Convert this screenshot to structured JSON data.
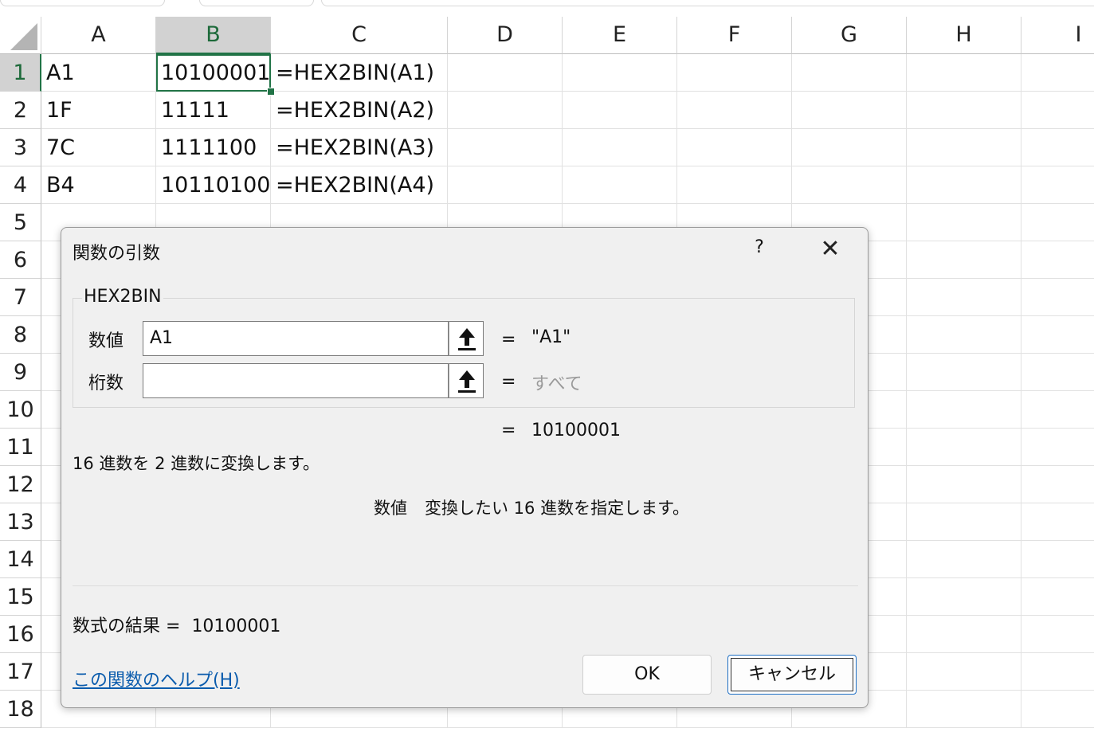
{
  "sheet": {
    "columns": [
      "A",
      "B",
      "C",
      "D",
      "E",
      "F",
      "G",
      "H",
      "I"
    ],
    "rows": [
      "1",
      "2",
      "3",
      "4",
      "5",
      "6",
      "7",
      "8",
      "9",
      "10",
      "11",
      "12",
      "13",
      "14",
      "15",
      "16",
      "17",
      "18"
    ],
    "cells": [
      {
        "a": "A1",
        "b": "10100001",
        "c": "=HEX2BIN(A1)"
      },
      {
        "a": "1F",
        "b": "11111",
        "c": "=HEX2BIN(A2)"
      },
      {
        "a": "7C",
        "b": "1111100",
        "c": "=HEX2BIN(A3)"
      },
      {
        "a": "B4",
        "b": "10110100",
        "c": "=HEX2BIN(A4)"
      }
    ],
    "active_cell": "B1"
  },
  "dialog": {
    "title": "関数の引数",
    "help_symbol": "?",
    "close_symbol": "✕",
    "function_name": "HEX2BIN",
    "args": [
      {
        "label": "数値",
        "value": "A1",
        "eq": "=",
        "result": "\"A1\""
      },
      {
        "label": "桁数",
        "value": "",
        "eq": "=",
        "result": "すべて"
      }
    ],
    "result_eq": "=",
    "result_value": "10100001",
    "description": "16 進数を 2 進数に変換します。",
    "arg_desc_name": "数値",
    "arg_desc_text": "変換したい 16 進数を指定します。",
    "formula_result_label": "数式の結果 =",
    "formula_result_value": "10100001",
    "help_link": "この関数のヘルプ(H)",
    "ok_label": "OK",
    "cancel_label": "キャンセル"
  }
}
